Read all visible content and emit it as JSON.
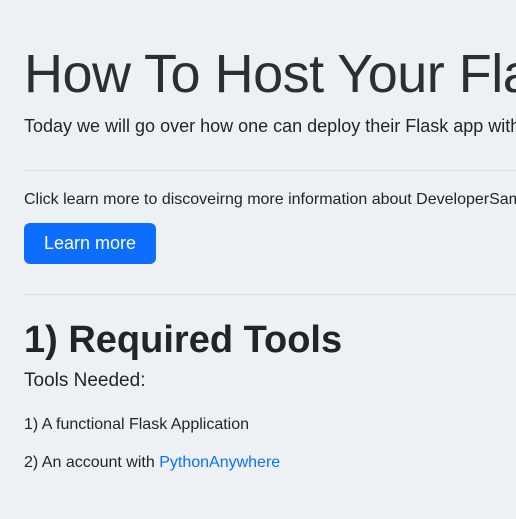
{
  "header": {
    "title": "How To Host Your Flask App",
    "subtitle": "Today we will go over how one can deploy their Flask app with PythonAnywhere"
  },
  "cta": {
    "text": "Click learn more to discoveirng more information about DeveloperSam",
    "button_label": "Learn more"
  },
  "section": {
    "heading": "1) Required Tools",
    "subheading": "Tools Needed:",
    "items": [
      {
        "prefix": "1) ",
        "text": "A functional Flask Application",
        "link": null
      },
      {
        "prefix": "2) ",
        "text": "An account with ",
        "link": "PythonAnywhere"
      }
    ]
  }
}
